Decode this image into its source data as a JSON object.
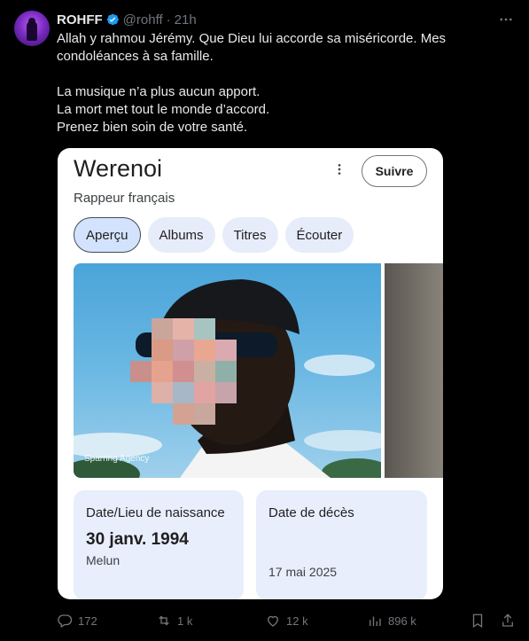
{
  "tweet": {
    "author_name": "ROHFF",
    "handle": "@rohff",
    "separator": "·",
    "time": "21h",
    "lines": [
      "Allah y rahmou Jérémy. Que Dieu lui accorde sa miséricorde. Mes condoléances à sa famille.",
      "La musique n’a plus aucun apport.",
      "La mort met tout le monde d’accord.",
      "Prenez bien soin de votre santé."
    ]
  },
  "card": {
    "title": "Werenoi",
    "subtitle": "Rappeur français",
    "follow_label": "Suivre",
    "chips": [
      "Aperçu",
      "Albums",
      "Titres",
      "Écouter"
    ],
    "photo_credit": "Sparring Agency",
    "birth": {
      "label": "Date/Lieu de naissance",
      "date": "30 janv. 1994",
      "place": "Melun"
    },
    "death": {
      "label": "Date de décès",
      "date": "17 mai 2025"
    }
  },
  "actions": {
    "replies": "172",
    "reposts": "1 k",
    "likes": "12 k",
    "views": "896 k"
  },
  "colors": {
    "background": "#000000",
    "text": "#e7e9ea",
    "muted": "#71767b",
    "verified": "#1d9bf0",
    "chip": "#e7ecfa"
  }
}
